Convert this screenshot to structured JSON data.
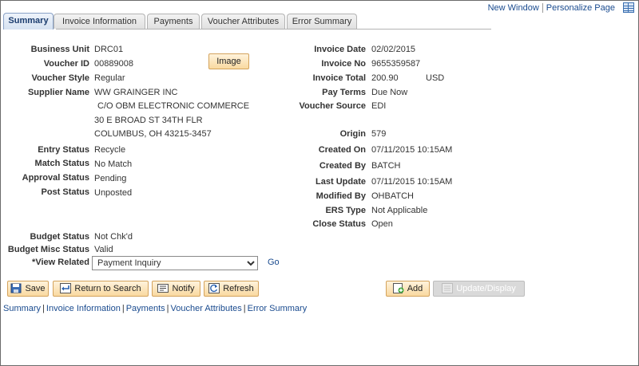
{
  "header_links": {
    "new_window": "New Window",
    "personalize": "Personalize Page"
  },
  "tabs": [
    {
      "label": "Summary"
    },
    {
      "label": "Invoice Information"
    },
    {
      "label": "Payments"
    },
    {
      "label": "Voucher Attributes"
    },
    {
      "label": "Error Summary"
    }
  ],
  "left": {
    "business_unit": {
      "label": "Business Unit",
      "value": "DRC01"
    },
    "voucher_id": {
      "label": "Voucher ID",
      "value": "00889008"
    },
    "image_button": "Image",
    "voucher_style": {
      "label": "Voucher Style",
      "value": "Regular"
    },
    "supplier_name": {
      "label": "Supplier Name",
      "value": "WW GRAINGER INC"
    },
    "address": [
      "C/O OBM ELECTRONIC COMMERCE",
      "30 E BROAD ST 34TH FLR",
      "COLUMBUS, OH  43215-3457"
    ],
    "entry_status": {
      "label": "Entry Status",
      "value": "Recycle"
    },
    "match_status": {
      "label": "Match Status",
      "value": "No Match"
    },
    "approval_status": {
      "label": "Approval Status",
      "value": "Pending"
    },
    "post_status": {
      "label": "Post Status",
      "value": "Unposted"
    },
    "budget_status": {
      "label": "Budget Status",
      "value": "Not Chk'd"
    },
    "budget_misc_status": {
      "label": "Budget Misc Status",
      "value": "Valid"
    },
    "view_related": {
      "label": "*View Related",
      "value": "Payment Inquiry",
      "go": "Go"
    }
  },
  "right": {
    "invoice_date": {
      "label": "Invoice Date",
      "value": "02/02/2015"
    },
    "invoice_no": {
      "label": "Invoice No",
      "value": "9655359587"
    },
    "invoice_total": {
      "label": "Invoice Total",
      "value": "200.90",
      "currency": "USD"
    },
    "pay_terms": {
      "label": "Pay Terms",
      "value": "Due Now"
    },
    "voucher_source": {
      "label": "Voucher Source",
      "value": "EDI"
    },
    "origin": {
      "label": "Origin",
      "value": "579"
    },
    "created_on": {
      "label": "Created On",
      "value": "07/11/2015 10:15AM"
    },
    "created_by": {
      "label": "Created By",
      "value": "BATCH"
    },
    "last_update": {
      "label": "Last Update",
      "value": "07/11/2015 10:15AM"
    },
    "modified_by": {
      "label": "Modified By",
      "value": "OHBATCH"
    },
    "ers_type": {
      "label": "ERS Type",
      "value": "Not Applicable"
    },
    "close_status": {
      "label": "Close Status",
      "value": "Open"
    }
  },
  "toolbar": {
    "save": "Save",
    "return_to_search": "Return to Search",
    "notify": "Notify",
    "refresh": "Refresh",
    "add": "Add",
    "update_display": "Update/Display"
  },
  "footer_links": [
    "Summary",
    "Invoice Information",
    "Payments",
    "Voucher Attributes",
    "Error Summary"
  ],
  "colors": {
    "link": "#1a4b8f",
    "button_bg": "#f9d9a0",
    "button_border": "#d4a35c",
    "disabled_button": "#d9d9d9"
  }
}
